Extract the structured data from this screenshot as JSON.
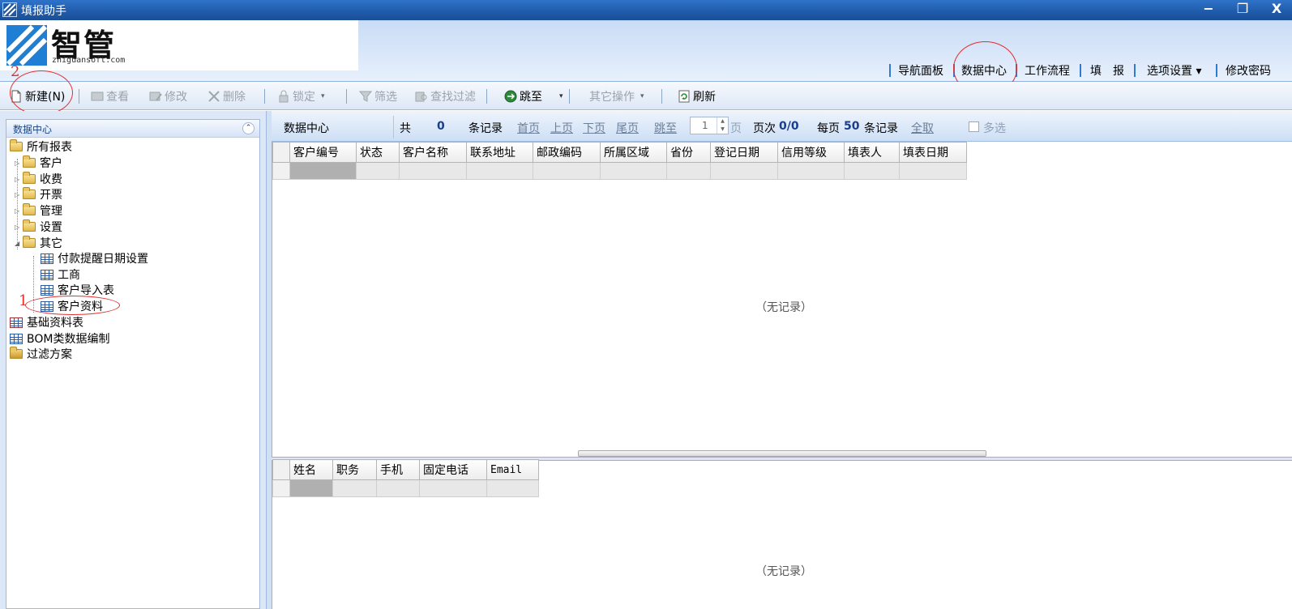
{
  "window": {
    "title": "填报助手",
    "buttons": {
      "minimize": "−",
      "maximize": "❐",
      "close": "X"
    }
  },
  "logo": {
    "text": "智管",
    "subtitle": "zhiguansoft.com"
  },
  "topnav": [
    {
      "label": "导航面板"
    },
    {
      "label": "数据中心"
    },
    {
      "label": "工作流程"
    },
    {
      "label": "填　报"
    },
    {
      "label": "选项设置 ▾"
    },
    {
      "label": "修改密码"
    }
  ],
  "annotations": {
    "one": "1",
    "two": "2"
  },
  "toolbar": {
    "new": "新建(N)",
    "view": "查看",
    "edit": "修改",
    "delete": "删除",
    "lock": "锁定",
    "filter": "筛选",
    "find_filter": "查找过滤",
    "jump": "跳至",
    "other_ops": "其它操作",
    "refresh": "刷新"
  },
  "leftpanel": {
    "title": "数据中心",
    "tree": {
      "root": "所有报表",
      "children": [
        "客户",
        "收费",
        "开票",
        "管理",
        "设置",
        "其它"
      ],
      "other_items": [
        "付款提醒日期设置",
        "工商",
        "客户导入表",
        "客户资料"
      ],
      "extra": [
        "基础资料表",
        "BOM类数据编制",
        "过滤方案"
      ]
    }
  },
  "datacenter": {
    "label": "数据中心",
    "total_prefix": "共",
    "total_count": "0",
    "records_label": "条记录",
    "first": "首页",
    "prev": "上页",
    "next": "下页",
    "last": "尾页",
    "goto": "跳至",
    "page_input": "1",
    "page_unit": "页",
    "page_no_label": "页次",
    "page_no": "0/0",
    "per_page_label": "每页",
    "per_page": "50",
    "per_page_suffix": "条记录",
    "select_all": "全取",
    "multi_select": "多选"
  },
  "grid1": {
    "columns": [
      "客户编号",
      "状态",
      "客户名称",
      "联系地址",
      "邮政编码",
      "所属区域",
      "省份",
      "登记日期",
      "信用等级",
      "填表人",
      "填表日期"
    ],
    "empty_text": "（无记录）"
  },
  "grid2": {
    "columns": [
      "姓名",
      "职务",
      "手机",
      "固定电话",
      "Email"
    ],
    "empty_text": "（无记录）"
  }
}
